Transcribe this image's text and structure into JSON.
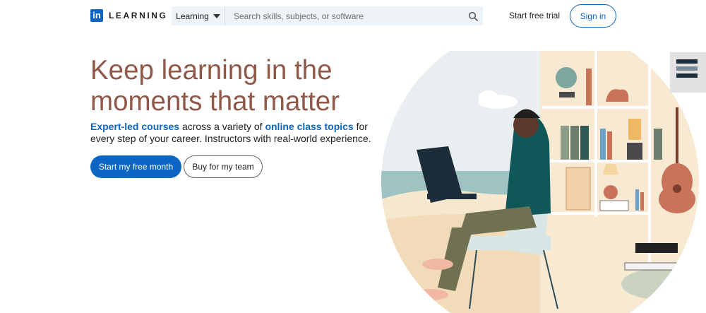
{
  "header": {
    "logo_mark": "in",
    "logo_text": "LEARNING",
    "search": {
      "scope_label": "Learning",
      "placeholder": "Search skills, subjects, or software"
    },
    "start_trial_label": "Start free trial",
    "sign_in_label": "Sign in"
  },
  "hero": {
    "headline": "Keep learning in the moments that matter",
    "subtitle": {
      "link1": "Expert-led courses",
      "text1": " across a variety of ",
      "link2": "online class topics",
      "text2": " for every step of your career. Instructors with real-world experience."
    },
    "primary_cta": "Start my free month",
    "secondary_cta": "Buy for my team"
  },
  "icons": {
    "search": "search-icon",
    "dropdown": "chevron-down-icon"
  },
  "colors": {
    "brand_blue": "#0a66c2",
    "headline": "#8f5849",
    "search_bg": "#eef3f8"
  }
}
